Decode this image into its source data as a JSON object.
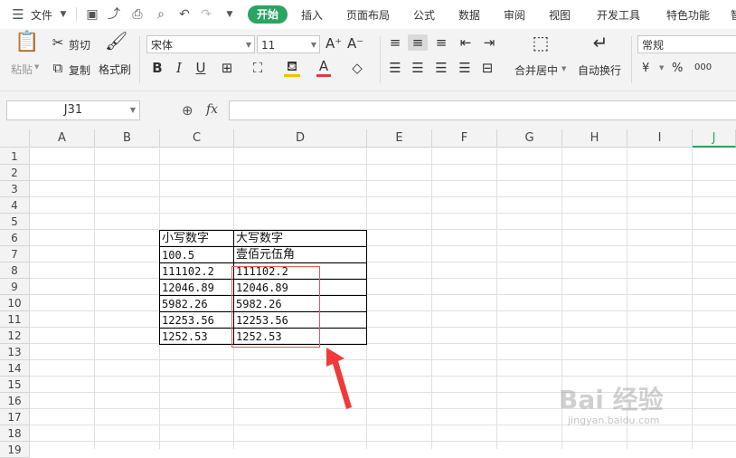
{
  "menubar": {
    "file": "文件",
    "tabs": [
      "开始",
      "插入",
      "页面布局",
      "公式",
      "数据",
      "审阅",
      "视图",
      "开发工具",
      "特色功能",
      "智"
    ]
  },
  "ribbon": {
    "paste": "粘贴",
    "cut": "剪切",
    "copy": "复制",
    "format_painter": "格式刷",
    "font_name": "宋体",
    "font_size": "11",
    "merge_center": "合并居中",
    "wrap_text": "自动换行",
    "number_format": "常规",
    "currency_symbol": "¥",
    "percent_symbol": "%",
    "thousands_symbol": "000"
  },
  "formula_bar": {
    "name_box": "J31",
    "fx": "fx",
    "value": ""
  },
  "sheet": {
    "columns": [
      "A",
      "B",
      "C",
      "D",
      "E",
      "F",
      "G",
      "H",
      "I",
      "J"
    ],
    "rows": [
      "1",
      "2",
      "3",
      "4",
      "5",
      "6",
      "7",
      "8",
      "9",
      "10",
      "11",
      "12",
      "13",
      "14",
      "15",
      "16",
      "17",
      "18",
      "19"
    ],
    "table": [
      [
        "小写数字",
        "大写数字"
      ],
      [
        "100.5",
        "壹佰元伍角"
      ],
      [
        "111102.2",
        "111102.2"
      ],
      [
        "12046.89",
        "12046.89"
      ],
      [
        "5982.26",
        "5982.26"
      ],
      [
        "12253.56",
        "12253.56"
      ],
      [
        "1252.53",
        "1252.53"
      ]
    ]
  },
  "colors": {
    "accent": "#2aa461",
    "highlight_box": "#e05a5a",
    "arrow": "#f03a3a"
  },
  "watermark": {
    "brand": "Bai 经验",
    "url": "jingyan.baidu.com"
  }
}
